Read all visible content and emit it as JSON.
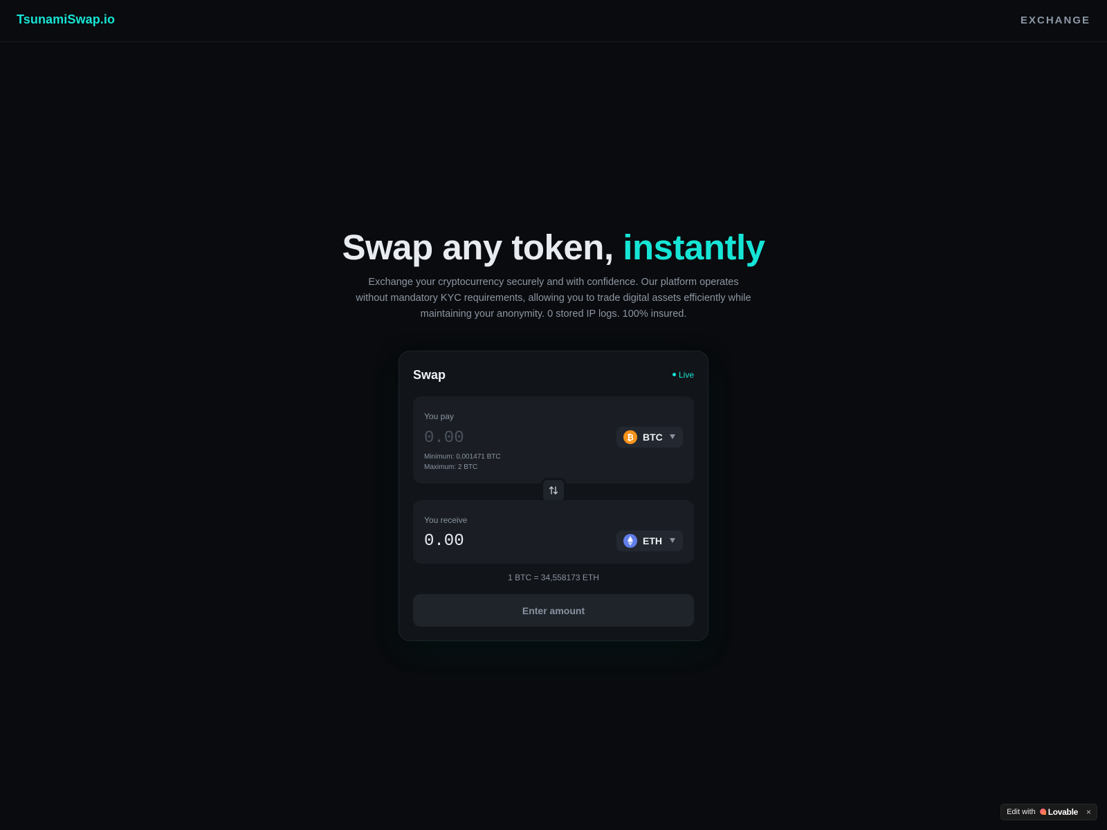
{
  "header": {
    "brand": "TsunamiSwap.io",
    "nav_exchange": "EXCHANGE"
  },
  "hero": {
    "title_main": "Swap any token, ",
    "title_accent": "instantly",
    "subtitle": "Exchange your cryptocurrency securely and with confidence. Our platform operates without mandatory KYC requirements, allowing you to trade digital assets efficiently while maintaining your anonymity. 0 stored IP logs. 100% insured."
  },
  "swap_card": {
    "title": "Swap",
    "live_label": "Live",
    "pay": {
      "label": "You pay",
      "placeholder": "0.00",
      "value": "",
      "token_symbol": "BTC",
      "token_icon": "bitcoin-icon",
      "minimum": "Minimum: 0,001471 BTC",
      "maximum": "Maximum: 2 BTC"
    },
    "receive": {
      "label": "You receive",
      "value": "0.00",
      "token_symbol": "ETH",
      "token_icon": "ethereum-icon"
    },
    "rate": "1 BTC = 34,558173 ETH",
    "cta_label": "Enter amount"
  },
  "badge": {
    "edit_label": "Edit with",
    "brand": "Lovable",
    "close": "×"
  },
  "colors": {
    "background": "#090b0e",
    "accent": "#16e5d6",
    "card": "#111419",
    "panel": "#1a1e24",
    "btc": "#f7931a",
    "eth": "#627eea"
  }
}
